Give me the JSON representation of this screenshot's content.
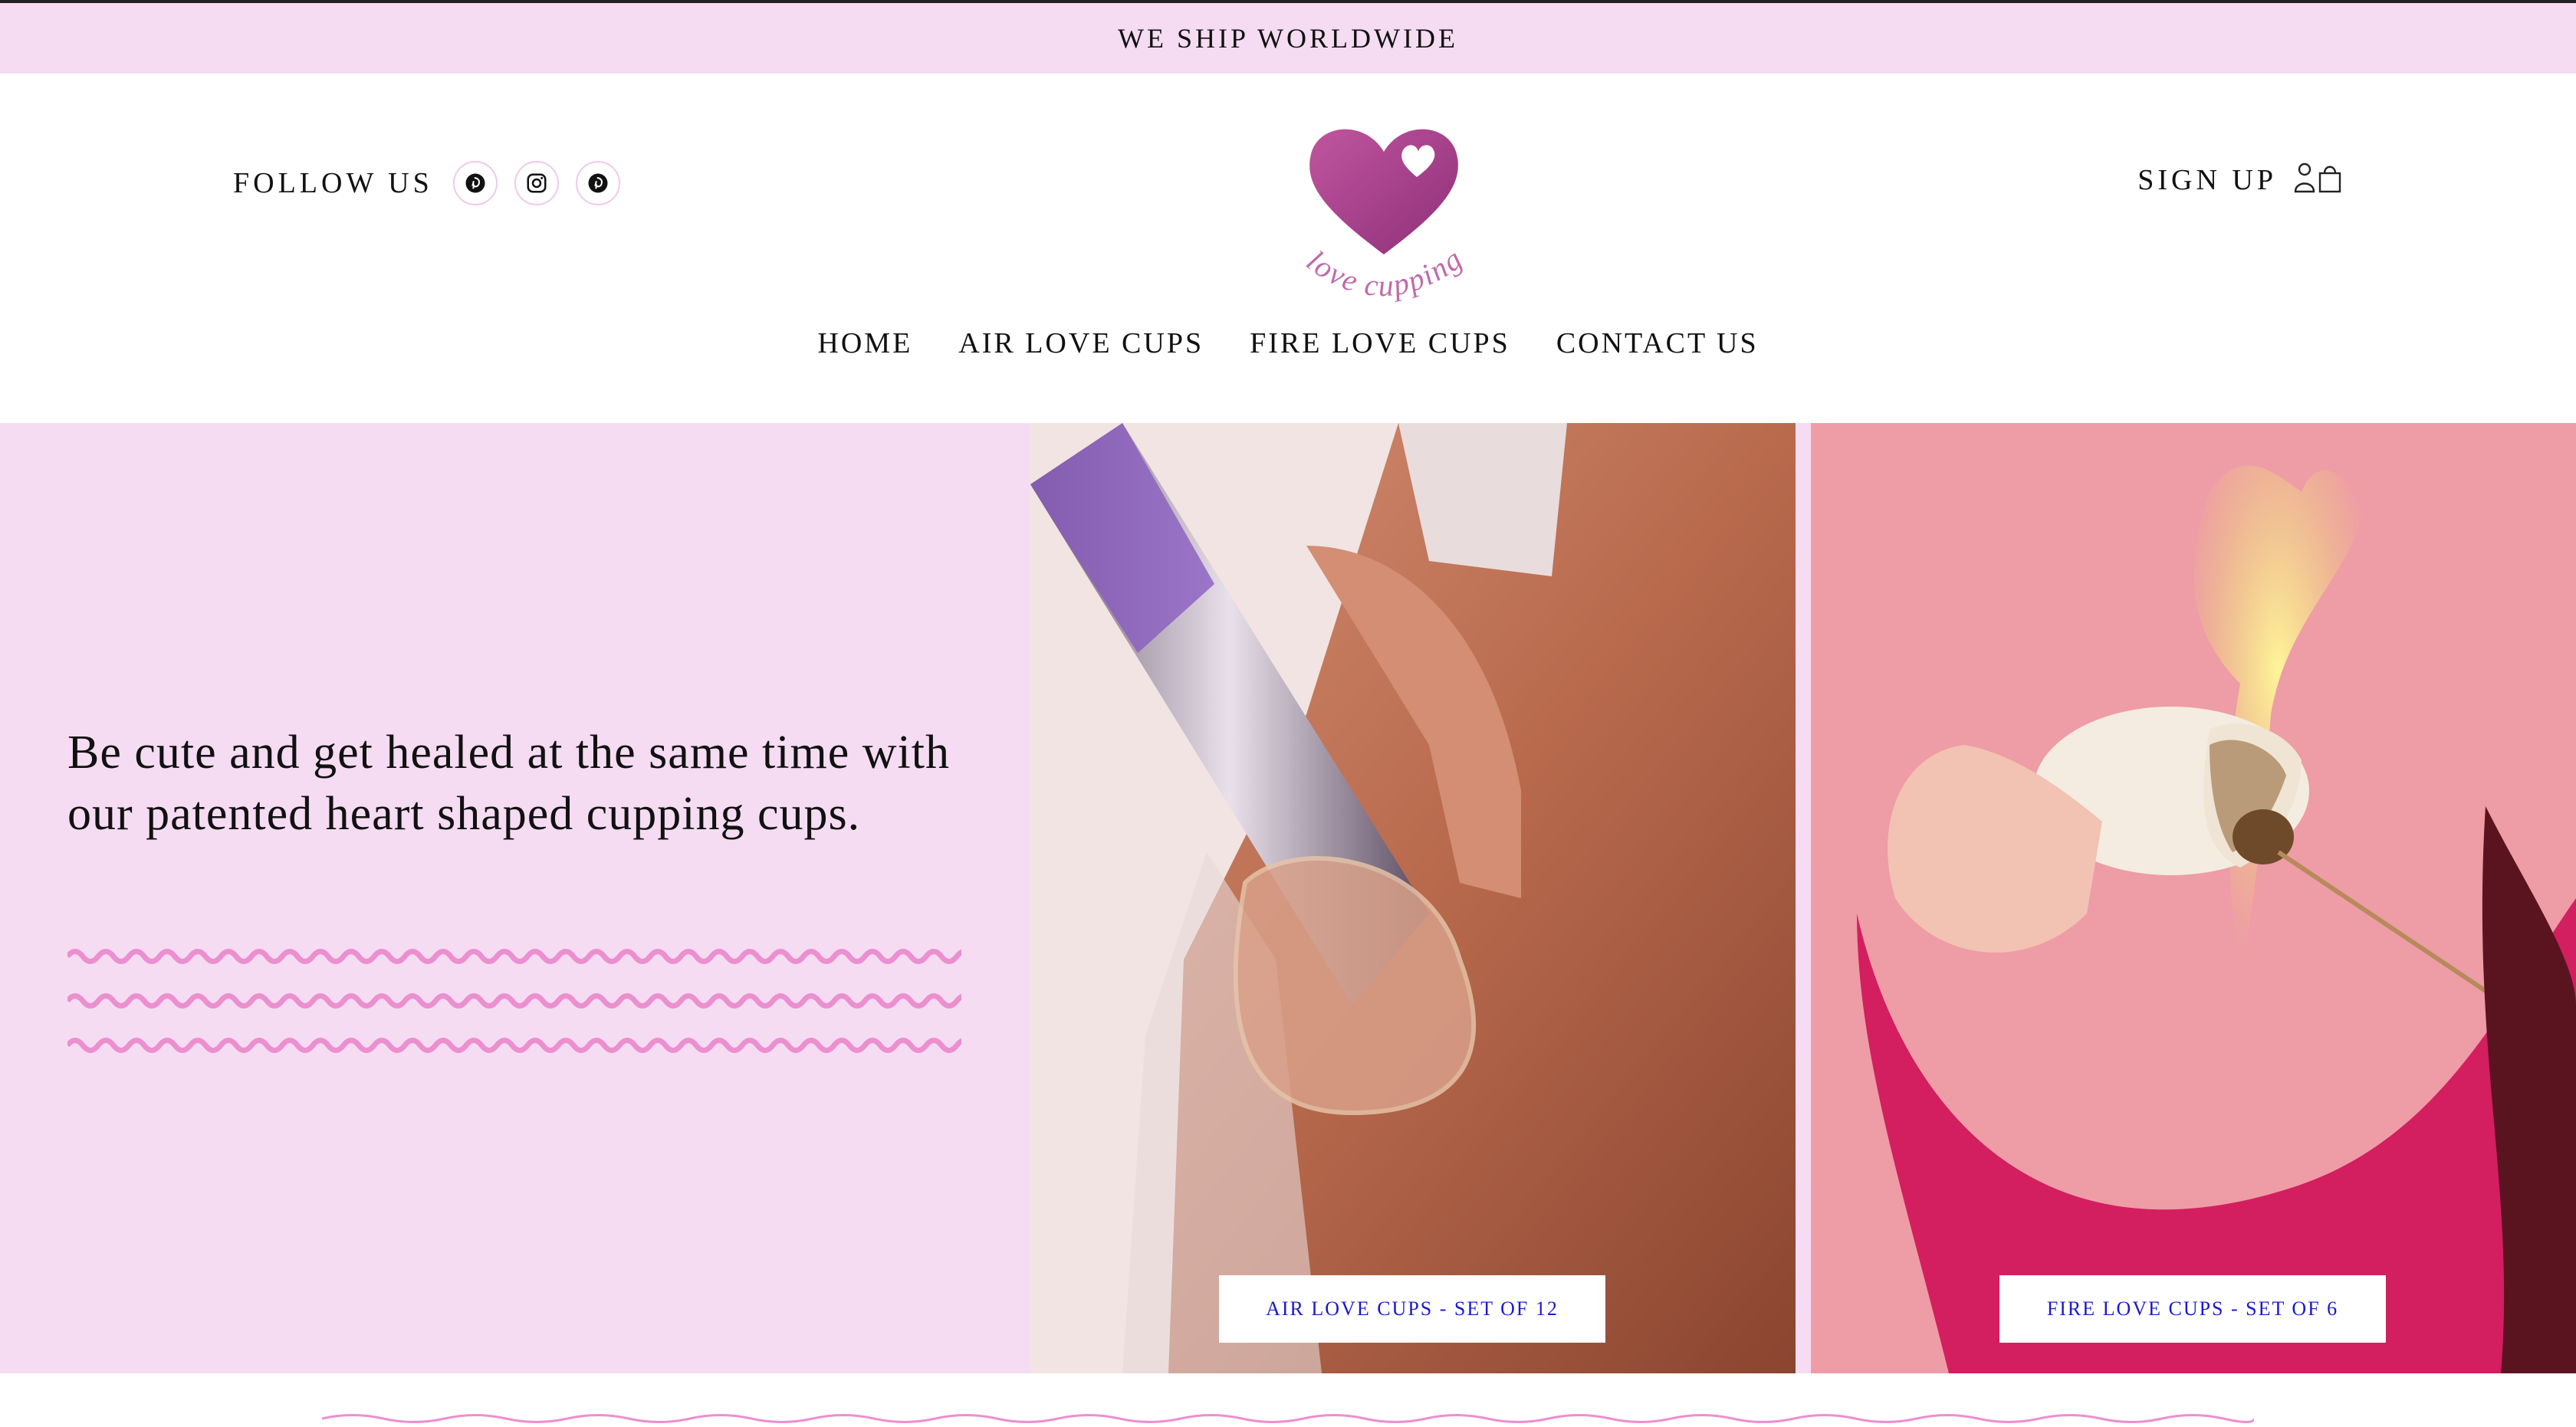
{
  "announcement": {
    "text": "WE SHIP WORLDWIDE"
  },
  "header": {
    "follow_label": "FOLLOW US",
    "social_icons": [
      "pinterest-icon",
      "instagram-icon",
      "pinterest-icon"
    ],
    "logo_text": "love cupping",
    "signup_label": "SIGN UP",
    "signup_icons": [
      "account-icon",
      "shopping-bag-icon"
    ]
  },
  "nav": {
    "items": [
      {
        "label": "HOME"
      },
      {
        "label": "AIR LOVE CUPS"
      },
      {
        "label": "FIRE LOVE CUPS"
      },
      {
        "label": "CONTACT US"
      }
    ]
  },
  "hero": {
    "tagline": "Be cute and get healed at the same time with our patented heart shaped cupping cups.",
    "panels": [
      {
        "button_label": "AIR LOVE CUPS - SET OF 12"
      },
      {
        "button_label": "FIRE LOVE CUPS - SET OF 6"
      }
    ]
  },
  "colors": {
    "pink_bg": "#f5dcf2",
    "logo_heart": "#a63c8c",
    "wave": "#ec8fcf",
    "button_text": "#1a1acb"
  }
}
